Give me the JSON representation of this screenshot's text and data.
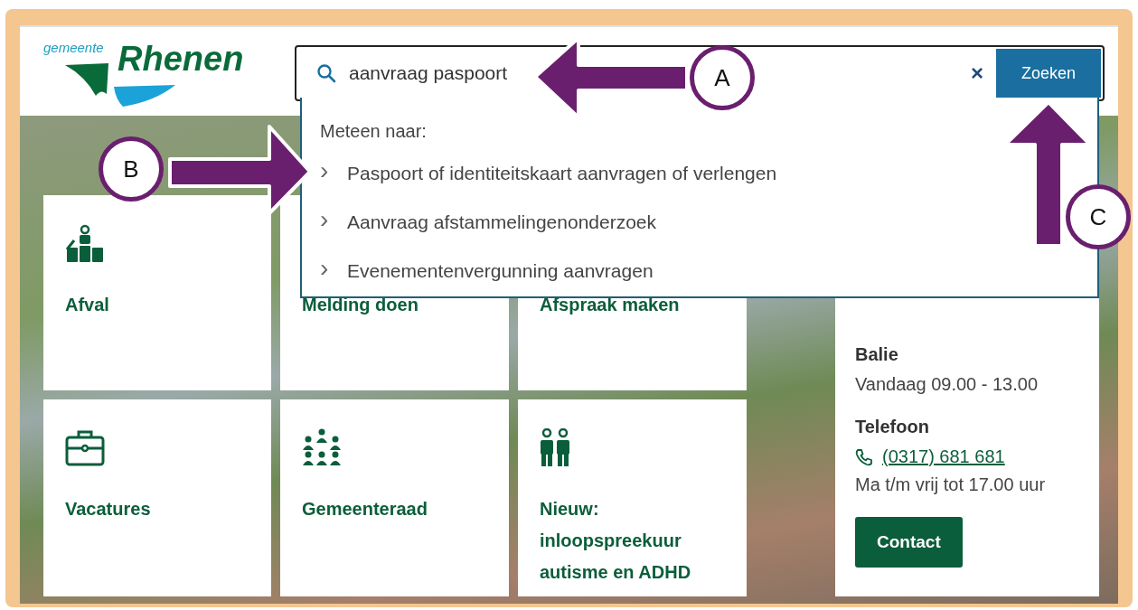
{
  "header": {
    "logo": {
      "prefix": "gemeente",
      "name": "Rhenen"
    }
  },
  "search": {
    "value": "aanvraag paspoort",
    "clear": "×",
    "button": "Zoeken"
  },
  "suggestions": {
    "heading": "Meteen naar:",
    "items": [
      {
        "chevron": "›",
        "label": "Paspoort of identiteitskaart aanvragen of verlengen"
      },
      {
        "chevron": "›",
        "label": "Aanvraag afstammelingenonderzoek"
      },
      {
        "chevron": "›",
        "label": "Evenementenvergunning aanvragen"
      }
    ]
  },
  "tiles": [
    {
      "kind": "bins",
      "title": "Afval"
    },
    {
      "kind": "hidden",
      "title": "Melding doen"
    },
    {
      "kind": "hidden",
      "title": "Afspraak maken"
    },
    {
      "kind": "briefcase",
      "title": "Vacatures"
    },
    {
      "kind": "group",
      "title": "Gemeenteraad"
    },
    {
      "kind": "pair",
      "title": "Nieuw: inloopspreekuur autisme en ADHD"
    }
  ],
  "info": {
    "sections": [
      {
        "heading": "Balie",
        "lines": [
          "Vandaag 09.00 - 13.00"
        ]
      },
      {
        "heading": "Telefoon",
        "phone": "(0317) 681 681",
        "lines": [
          "Ma t/m vrij tot 17.00 uur"
        ]
      }
    ],
    "button": "Contact"
  },
  "annotations": [
    {
      "label": "A"
    },
    {
      "label": "B"
    },
    {
      "label": "C"
    }
  ]
}
